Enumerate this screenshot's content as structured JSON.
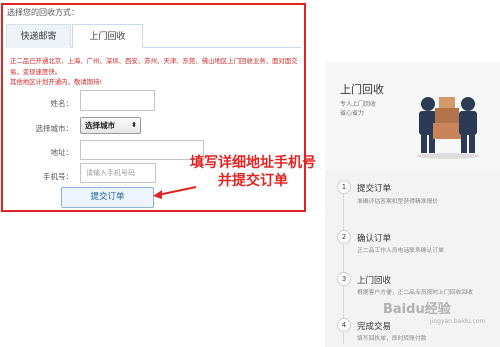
{
  "form": {
    "heading": "选择您的回收方式：",
    "tabs": [
      {
        "label": "快递邮寄",
        "active": false
      },
      {
        "label": "上门回收",
        "active": true
      }
    ],
    "notice_lines": [
      "正二品已开通北京、上海、广州、深圳、西安、苏州、天津、东莞、佛山地区上门回收业务，面对面交",
      "易，变现速度快。",
      "其他地区计划开通内，敬请期待!"
    ],
    "fields": {
      "name_label": "姓名：",
      "city_label": "选择城市：",
      "city_value": "选择城市",
      "address_label": "地址：",
      "phone_label": "手机号：",
      "phone_placeholder": "请输入手机号码"
    },
    "submit_label": "提交订单"
  },
  "annotation": {
    "lines": [
      "填写详细地址手机号",
      "并提交订单"
    ],
    "color": "#e02424"
  },
  "right_panel": {
    "title": "上门回收",
    "subtitles": [
      "专人上门回收",
      "省心省力"
    ],
    "steps": [
      {
        "num": "1",
        "title": "提交订单",
        "desc": "准确评估答案机型获得精准报价"
      },
      {
        "num": "2",
        "title": "确认订单",
        "desc": "正二品工作人员电话联系确认订单"
      },
      {
        "num": "3",
        "title": "上门回收",
        "desc": "根据客户方便，正二品专员按时上门回收回收"
      },
      {
        "num": "4",
        "title": "完成交易",
        "desc": "填写回执单，即时转账付款"
      }
    ]
  },
  "watermark": {
    "text": "Baidu经验",
    "sub": "jingyan.baidu.com"
  }
}
